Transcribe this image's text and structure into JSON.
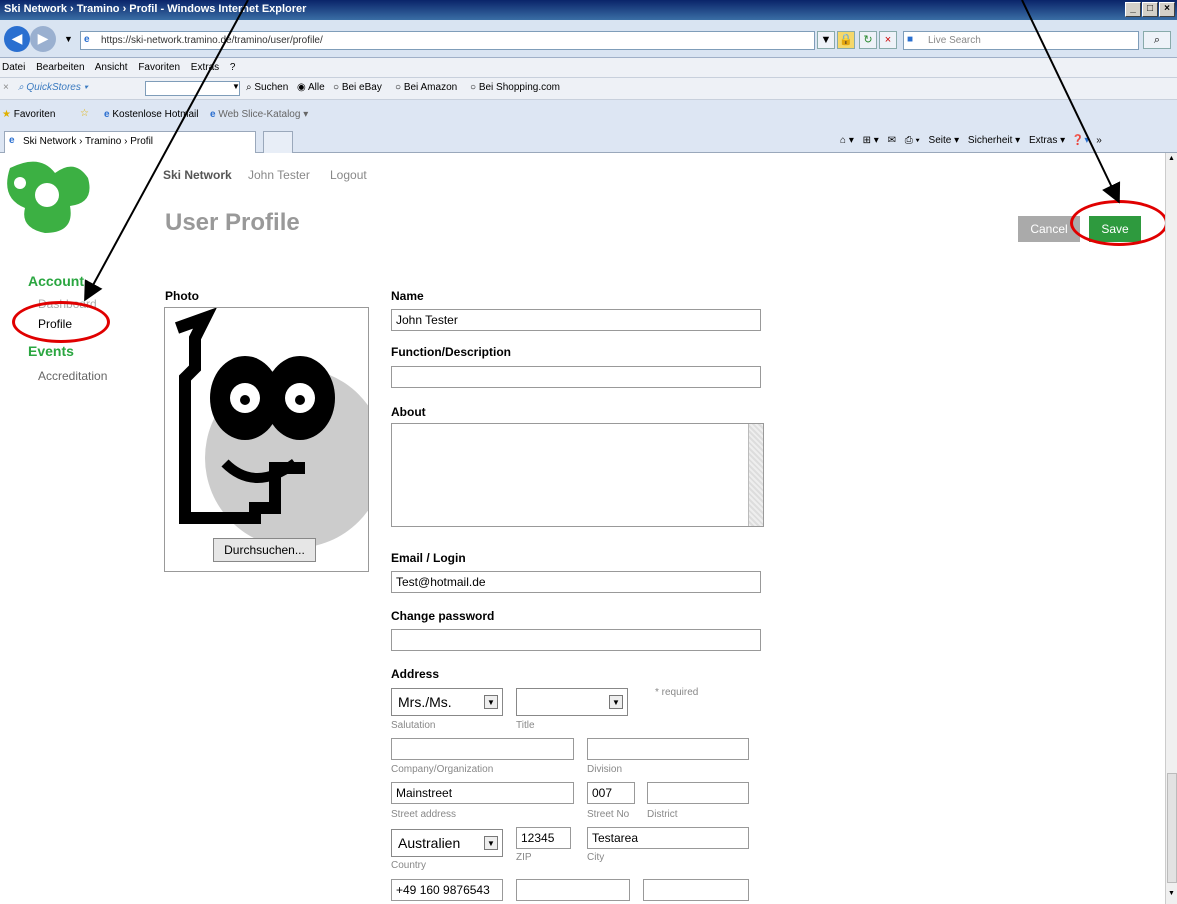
{
  "window": {
    "title": "Ski Network › Tramino › Profil - Windows Internet Explorer"
  },
  "browser": {
    "url": "https://ski-network.tramino.de/tramino/user/profile/",
    "search_placeholder": "Live Search",
    "menu": [
      "Datei",
      "Bearbeiten",
      "Ansicht",
      "Favoriten",
      "Extras",
      "?"
    ],
    "quickstores": {
      "label": "QuickStores",
      "search": "Suchen",
      "options": [
        "Alle",
        "Bei eBay",
        "Bei Amazon",
        "Bei Shopping.com"
      ]
    },
    "favorites": {
      "label": "Favoriten",
      "items": [
        "Kostenlose Hotmail",
        "Web Slice-Katalog"
      ]
    },
    "tab": {
      "title": "Ski Network › Tramino › Profil"
    },
    "command_bar": [
      "Seite",
      "Sicherheit",
      "Extras"
    ]
  },
  "site": {
    "topnav": [
      "Ski Network",
      "John Tester",
      "Logout"
    ],
    "heading": "User Profile",
    "cancel_label": "Cancel",
    "save_label": "Save",
    "sidebar": {
      "account": "Account",
      "account_items": [
        "Dashboard",
        "Profile"
      ],
      "events": "Events",
      "events_items": [
        "Accreditation"
      ]
    },
    "photo": {
      "label": "Photo",
      "browse_label": "Durchsuchen..."
    },
    "form": {
      "name_label": "Name",
      "name_value": "John Tester",
      "function_label": "Function/Description",
      "function_value": "",
      "about_label": "About",
      "email_label": "Email / Login",
      "email_value": "Test@hotmail.de",
      "password_label": "Change password",
      "address_label": "Address",
      "salutation_value": "Mrs./Ms.",
      "salutation_label": "Salutation",
      "title_label": "Title",
      "required_note": "* required",
      "company_label": "Company/Organization",
      "division_label": "Division",
      "street_value": "Mainstreet",
      "street_label": "Street address",
      "streetno_value": "007",
      "streetno_label": "Street No",
      "district_label": "District",
      "country_value": "Australien",
      "country_label": "Country",
      "zip_value": "12345",
      "zip_label": "ZIP",
      "city_value": "Testarea",
      "city_label": "City",
      "phone_value": "+49 160 9876543"
    }
  }
}
